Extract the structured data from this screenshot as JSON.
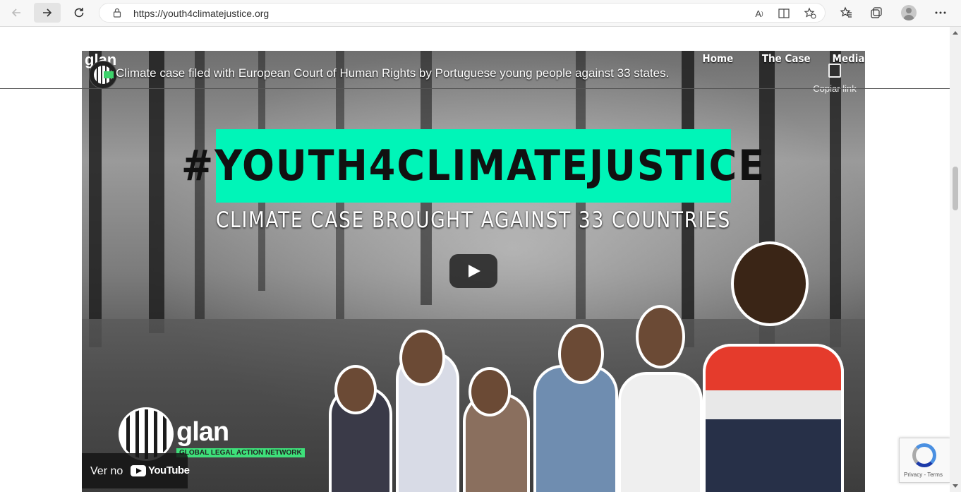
{
  "browser": {
    "url": "https://youth4climatejustice.org"
  },
  "video": {
    "title": "Climate case filed with European Court of Human Rights by Portuguese young people against 33 states.",
    "banner": "#YOUTH4CLIMATEJUSTICE",
    "subtitle": "CLIMATE CASE BROUGHT AGAINST 33 COUNTRIES",
    "copy_link": "Copiar link",
    "watch_on": "Ver no",
    "youtube": "YouTube",
    "channel_name": "glan",
    "channel_sub": "GLOBAL LEGAL ACTION NETWORK",
    "logo_word": "glan",
    "logo_tag": "GLOBAL LEGAL ACTION NETWORK"
  },
  "nav": {
    "items": [
      "Home",
      "The Case",
      "Media"
    ]
  },
  "recaptcha": {
    "links": "Privacy - Terms"
  },
  "colors": {
    "banner": "#00f5b8",
    "glan_green": "#3ee07a"
  }
}
